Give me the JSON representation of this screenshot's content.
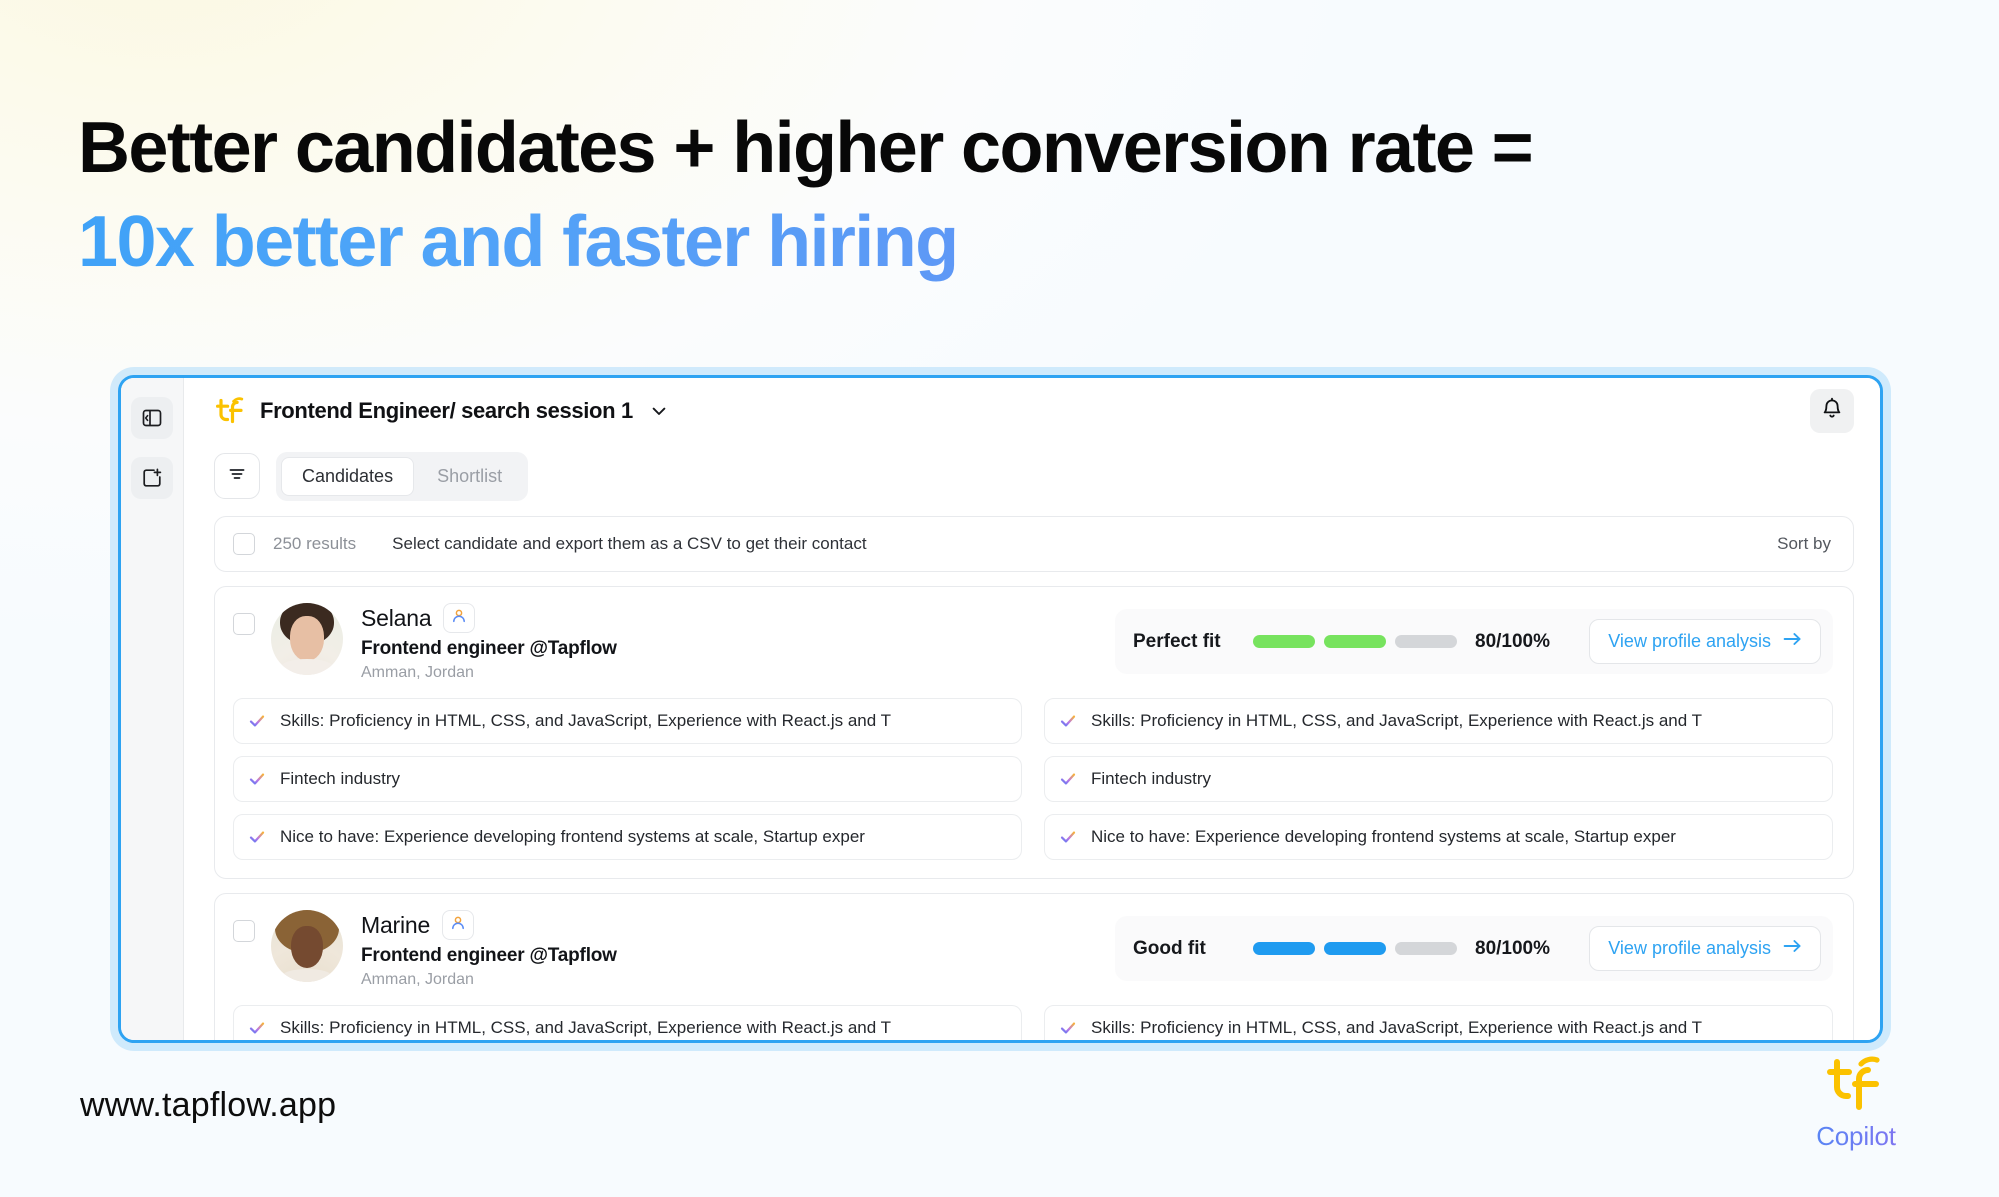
{
  "hero": {
    "line1": "Better candidates + higher conversion rate =",
    "line2": "10x better and faster hiring",
    "accent_color": "#4FA4F8",
    "gradient_end_color": "#7B82F2"
  },
  "app": {
    "rail": [
      {
        "name": "sidebar-toggle-icon",
        "label": "Toggle sidebar"
      },
      {
        "name": "new-search-icon",
        "label": "New search"
      }
    ],
    "header": {
      "logo": "tapflow-logo",
      "session_title": "Frontend Engineer/ search session 1",
      "chevron": "chevron-down-icon",
      "bell": "bell-icon"
    },
    "toolbar": {
      "filter_icon": "filter-icon",
      "tabs": [
        {
          "label": "Candidates",
          "active": true
        },
        {
          "label": "Shortlist",
          "active": false
        }
      ]
    },
    "results_bar": {
      "count": "250 results",
      "hint": "Select candidate and export them as a CSV to get their contact",
      "sort_by": "Sort by"
    },
    "candidates": [
      {
        "name": "Selana",
        "role": "Frontend engineer @Tapflow",
        "location": "Amman, Jordan",
        "badge_icon": "person-icon",
        "fit_label": "Perfect fit",
        "fit_score": "80/100%",
        "fit_color": "#77E35E",
        "fit_filled_segments": 2,
        "fit_total_segments": 3,
        "cta": "View profile analysis",
        "cta_icon": "arrow-right-icon",
        "criteria": [
          "Skills: Proficiency in HTML, CSS, and JavaScript, Experience with React.js and T",
          "Skills: Proficiency in HTML, CSS, and JavaScript, Experience with React.js and T",
          "Fintech industry",
          "Fintech industry",
          "Nice to have: Experience developing frontend systems at scale, Startup exper",
          "Nice to have: Experience developing frontend systems at scale, Startup exper"
        ]
      },
      {
        "name": "Marine",
        "role": "Frontend engineer @Tapflow",
        "location": "Amman, Jordan",
        "badge_icon": "person-icon",
        "fit_label": "Good fit",
        "fit_score": "80/100%",
        "fit_color": "#1F9BF0",
        "fit_filled_segments": 2,
        "fit_total_segments": 3,
        "cta": "View profile analysis",
        "cta_icon": "arrow-right-icon",
        "criteria": [
          "Skills: Proficiency in HTML, CSS, and JavaScript, Experience with React.js and T",
          "Skills: Proficiency in HTML, CSS, and JavaScript, Experience with React.js and T"
        ]
      }
    ]
  },
  "footer": {
    "url": "www.tapflow.app",
    "product_logo": "tapflow-logo",
    "product_name": "Copilot"
  }
}
